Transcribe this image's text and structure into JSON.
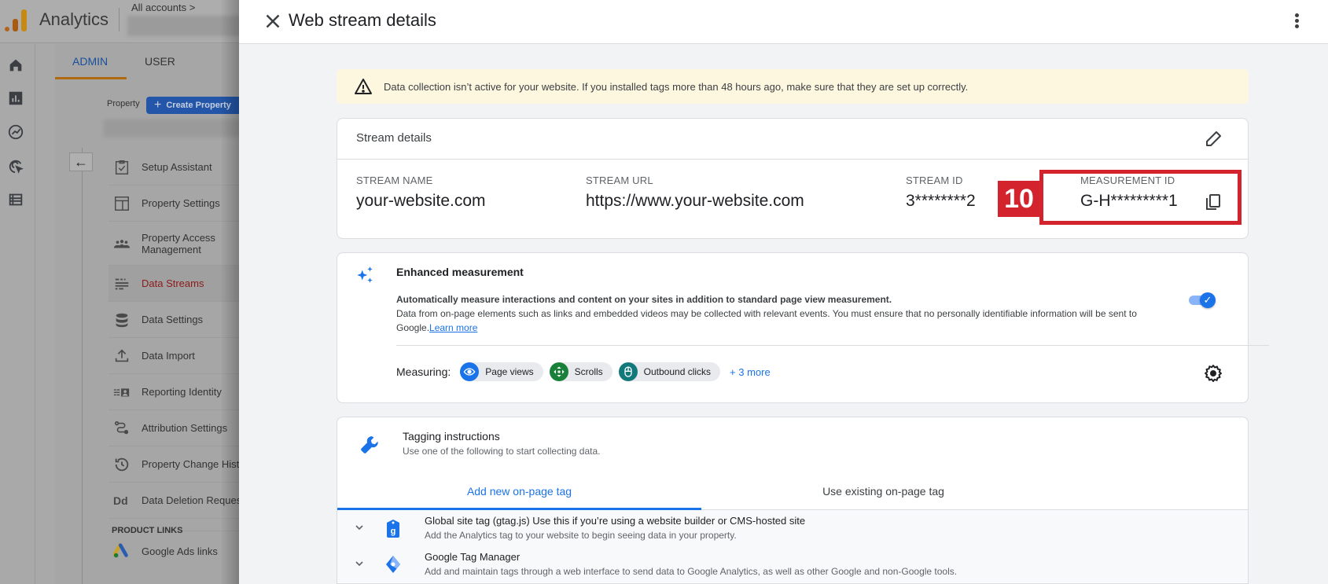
{
  "background_app": {
    "app_name": "Analytics",
    "breadcrumb": "All accounts >",
    "tabs": [
      {
        "label": "ADMIN",
        "active": true
      },
      {
        "label": "USER",
        "active": false
      }
    ],
    "property_label": "Property",
    "create_property_label": "Create Property",
    "nav_items": [
      {
        "label": "Setup Assistant",
        "icon": "clipboard-check-icon"
      },
      {
        "label": "Property Settings",
        "icon": "layout-icon"
      },
      {
        "label": "Property Access Management",
        "icon": "people-icon"
      },
      {
        "label": "Data Streams",
        "icon": "streams-icon",
        "active": true
      },
      {
        "label": "Data Settings",
        "icon": "database-icon"
      },
      {
        "label": "Data Import",
        "icon": "upload-icon"
      },
      {
        "label": "Reporting Identity",
        "icon": "identity-icon"
      },
      {
        "label": "Attribution Settings",
        "icon": "route-icon"
      },
      {
        "label": "Property Change History",
        "icon": "history-icon"
      },
      {
        "label": "Data Deletion Requests",
        "icon": "dd-icon"
      }
    ],
    "product_links_heading": "PRODUCT LINKS",
    "product_links": [
      {
        "label": "Google Ads links",
        "icon": "google-ads-icon"
      }
    ]
  },
  "drawer": {
    "title": "Web stream details",
    "alert": "Data collection isn’t active for your website. If you installed tags more than 48 hours ago, make sure that they are set up correctly.",
    "stream_details": {
      "title": "Stream details",
      "fields": [
        {
          "label": "STREAM NAME",
          "value": "your-website.com"
        },
        {
          "label": "STREAM URL",
          "value": "https://www.your-website.com"
        },
        {
          "label": "STREAM ID",
          "value": "3********2"
        },
        {
          "label": "MEASUREMENT ID",
          "value": "G-H*********1"
        }
      ]
    },
    "annotation": {
      "badge": "10",
      "color": "#d3232c"
    },
    "enhanced_measurement": {
      "title": "Enhanced measurement",
      "desc_line1": "Automatically measure interactions and content on your sites in addition to standard page view measurement.",
      "desc_line2": "Data from on-page elements such as links and embedded videos may be collected with relevant events. You must ensure that no personally identifiable information will be sent to Google.",
      "learn_more": "Learn more",
      "enabled": true,
      "measuring_label": "Measuring:",
      "chips": [
        {
          "label": "Page views",
          "color": "#1a73e8"
        },
        {
          "label": "Scrolls",
          "color": "#188038"
        },
        {
          "label": "Outbound clicks",
          "color": "#12797a"
        }
      ],
      "more_label": "+ 3 more"
    },
    "tagging": {
      "title": "Tagging instructions",
      "subtitle": "Use one of the following to start collecting data.",
      "tabs": [
        {
          "label": "Add new on-page tag",
          "active": true
        },
        {
          "label": "Use existing on-page tag",
          "active": false
        }
      ],
      "items": [
        {
          "name": "Global site tag (gtag.js) Use this if you’re using a website builder or CMS-hosted site",
          "desc": "Add the Analytics tag to your website to begin seeing data in your property."
        },
        {
          "name": "Google Tag Manager",
          "desc": "Add and maintain tags through a web interface to send data to Google Analytics, as well as other Google and non-Google tools."
        }
      ]
    }
  }
}
